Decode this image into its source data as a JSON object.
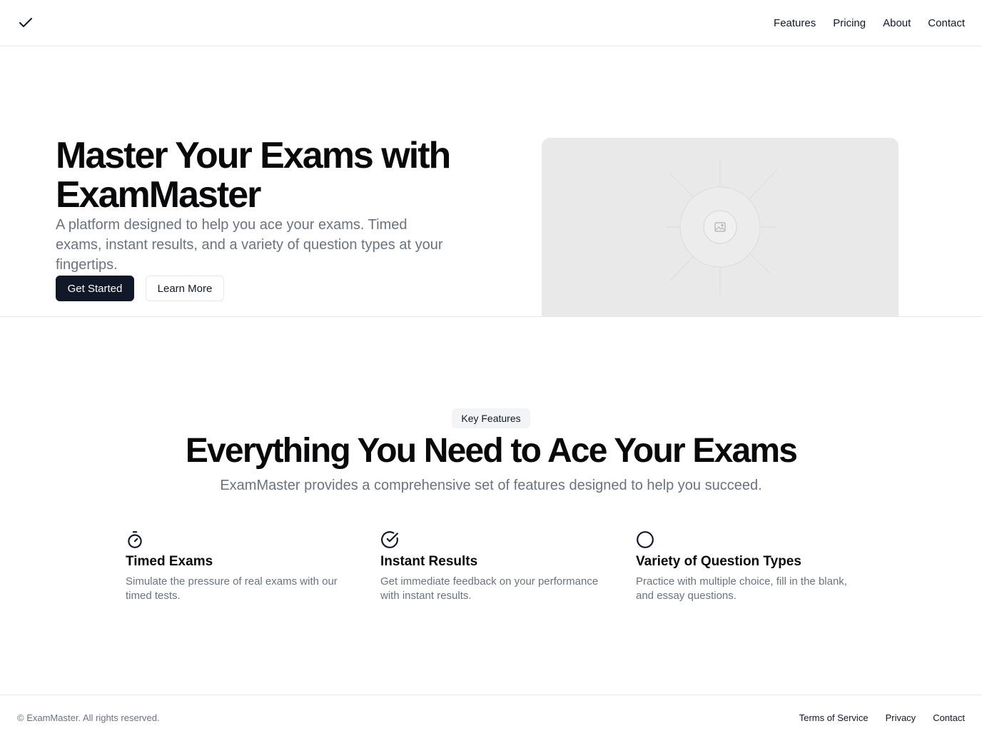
{
  "header": {
    "logo_icon": "checkmark-icon",
    "nav": [
      {
        "label": "Features"
      },
      {
        "label": "Pricing"
      },
      {
        "label": "About"
      },
      {
        "label": "Contact"
      }
    ]
  },
  "hero": {
    "title": "Master Your Exams with ExamMaster",
    "subtitle": "A platform designed to help you ace your exams. Timed exams, instant results, and a variety of question types at your fingertips.",
    "primary_button": "Get Started",
    "secondary_button": "Learn More",
    "image_icon": "image-placeholder-icon"
  },
  "features": {
    "badge": "Key Features",
    "title": "Everything You Need to Ace Your Exams",
    "subtitle": "ExamMaster provides a comprehensive set of features designed to help you succeed.",
    "items": [
      {
        "icon": "stopwatch-icon",
        "title": "Timed Exams",
        "description": "Simulate the pressure of real exams with our timed tests."
      },
      {
        "icon": "check-circle-icon",
        "title": "Instant Results",
        "description": "Get immediate feedback on your performance with instant results."
      },
      {
        "icon": "circle-icon",
        "title": "Variety of Question Types",
        "description": "Practice with multiple choice, fill in the blank, and essay questions."
      }
    ]
  },
  "footer": {
    "copyright": "© ExamMaster. All rights reserved.",
    "links": [
      {
        "label": "Terms of Service"
      },
      {
        "label": "Privacy"
      },
      {
        "label": "Contact"
      }
    ]
  },
  "colors": {
    "primary": "#111827",
    "muted_text": "#6b7280",
    "border": "#e5e7eb",
    "placeholder_bg": "#e9e9e9"
  }
}
